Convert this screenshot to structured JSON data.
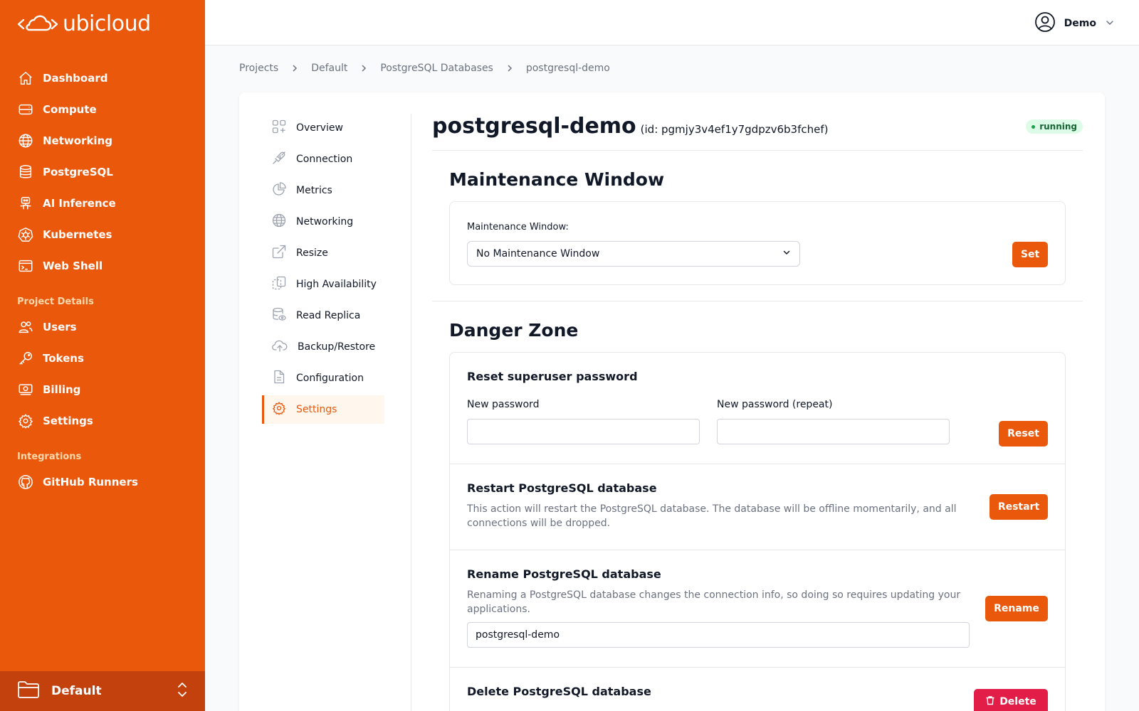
{
  "brand": {
    "name": "ubicloud"
  },
  "sidebar": {
    "items": [
      {
        "label": "Dashboard",
        "icon": "home-icon"
      },
      {
        "label": "Compute",
        "icon": "server-icon"
      },
      {
        "label": "Networking",
        "icon": "globe-icon"
      },
      {
        "label": "PostgreSQL",
        "icon": "database-icon"
      },
      {
        "label": "AI Inference",
        "icon": "robot-icon"
      },
      {
        "label": "Kubernetes",
        "icon": "kubernetes-icon"
      },
      {
        "label": "Web Shell",
        "icon": "terminal-icon"
      }
    ],
    "project_details_title": "Project Details",
    "project_items": [
      {
        "label": "Users",
        "icon": "users-icon"
      },
      {
        "label": "Tokens",
        "icon": "key-icon"
      },
      {
        "label": "Billing",
        "icon": "billing-icon"
      },
      {
        "label": "Settings",
        "icon": "gear-icon"
      }
    ],
    "integrations_title": "Integrations",
    "integration_items": [
      {
        "label": "GitHub Runners",
        "icon": "github-icon"
      }
    ],
    "project_switcher": "Default"
  },
  "topbar": {
    "user": "Demo"
  },
  "breadcrumb": [
    "Projects",
    "Default",
    "PostgreSQL Databases",
    "postgresql-demo"
  ],
  "subnav": {
    "items": [
      "Overview",
      "Connection",
      "Metrics",
      "Networking",
      "Resize",
      "High Availability",
      "Read Replica",
      "Backup/Restore",
      "Configuration",
      "Settings"
    ],
    "active": "Settings"
  },
  "database": {
    "name": "postgresql-demo",
    "id_text": "(id: pgmjy3v4ef1y7gdpzv6b3fchef)",
    "status": "running"
  },
  "maintenance": {
    "heading": "Maintenance Window",
    "label": "Maintenance Window:",
    "selected": "No Maintenance Window",
    "button": "Set"
  },
  "danger": {
    "heading": "Danger Zone",
    "reset": {
      "title": "Reset superuser password",
      "new_password_label": "New password",
      "repeat_label": "New password (repeat)",
      "button": "Reset"
    },
    "restart": {
      "title": "Restart PostgreSQL database",
      "desc": "This action will restart the PostgreSQL database. The database will be offline momentarily, and all connections will be dropped.",
      "button": "Restart"
    },
    "rename": {
      "title": "Rename PostgreSQL database",
      "desc": "Renaming a PostgreSQL database changes the connection info, so doing so requires updating your applications.",
      "value": "postgresql-demo",
      "button": "Rename"
    },
    "delete": {
      "title": "Delete PostgreSQL database",
      "button": "Delete"
    }
  },
  "colors": {
    "accent": "#ea580c",
    "danger": "#e11d48",
    "status_bg": "#dcfce7"
  }
}
